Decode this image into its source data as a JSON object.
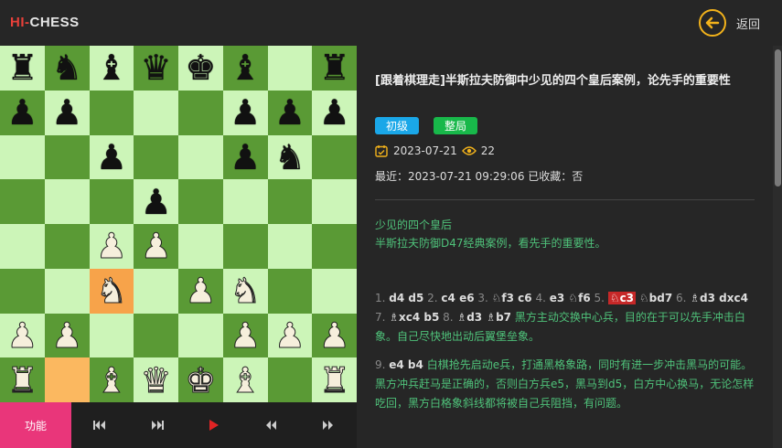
{
  "app": {
    "logo_hi": "HI",
    "logo_dash": "-",
    "logo_chess": "CHESS",
    "back_label": "返回"
  },
  "board": {
    "highlight_squares": [
      "c3",
      "b1"
    ],
    "rows": [
      [
        "bR",
        "bN",
        "bB",
        "bQ",
        "bK",
        "bB",
        "",
        "bR"
      ],
      [
        "bP",
        "bP",
        "",
        "",
        "",
        "bP",
        "bP",
        "bP"
      ],
      [
        "",
        "",
        "bP",
        "",
        "",
        "bP",
        "bN",
        ""
      ],
      [
        "",
        "",
        "",
        "bP",
        "",
        "",
        "",
        ""
      ],
      [
        "",
        "",
        "wP",
        "wP",
        "",
        "",
        "",
        ""
      ],
      [
        "",
        "",
        "wN",
        "",
        "wP",
        "wN",
        "",
        ""
      ],
      [
        "wP",
        "wP",
        "",
        "",
        "",
        "wP",
        "wP",
        "wP"
      ],
      [
        "wR",
        "",
        "wB",
        "wQ",
        "wK",
        "wB",
        "",
        "wR"
      ]
    ]
  },
  "controls": {
    "func_label": "功能",
    "buttons": [
      "first-icon",
      "prev-icon",
      "play-icon",
      "rewind-icon",
      "forward-icon"
    ],
    "play_color": "#e02424"
  },
  "article": {
    "title": "[跟着棋理走]半斯拉夫防御中少见的四个皇后案例，论先手的重要性",
    "badges": [
      "初级",
      "整局"
    ],
    "date": "2023-07-21",
    "views": "22",
    "recent": "最近：2023-07-21 09:29:06 已收藏：否",
    "desc_line1": "少见的四个皇后",
    "desc_line2": "半斯拉夫防御D47经典案例，看先手的重要性。",
    "moves_p1": [
      {
        "n": "1.",
        "m": "d4 d5"
      },
      {
        "n": "2.",
        "m": "c4 e6"
      },
      {
        "n": "3.",
        "m": "♘f3 c6"
      },
      {
        "n": "4.",
        "m": "e3 ♘f6"
      },
      {
        "n": "5.",
        "m": "♘c3",
        "hl": true
      },
      {
        "n": "",
        "m": "♘bd7"
      },
      {
        "n": "6.",
        "m": "♗d3 dxc4"
      },
      {
        "n": "7.",
        "m": "♗xc4 b5"
      },
      {
        "n": "8.",
        "m": "♗d3 ♗b7"
      }
    ],
    "comment1": "黑方主动交换中心兵，目的在于可以先手冲击白象。自己尽快地出动后翼堡垒象。",
    "moves_p2": [
      {
        "n": "9.",
        "m": "e4 b4"
      }
    ],
    "comment2": "白棋抢先启动e兵，打通黑格象路，同时有进一步冲击黑马的可能。黑方冲兵赶马是正确的，否则白方兵e5，黑马到d5，白方中心换马，无论怎样吃回，黑方白格象斜线都将被自己兵阻挡，有问题。"
  },
  "colors": {
    "accent_back": "#f2b21b",
    "func_btn": "#e9367a",
    "badge_level": "#1aa7e8",
    "badge_type": "#18b84a",
    "comment_text": "#4fc27a",
    "move_highlight": "#c62828"
  }
}
